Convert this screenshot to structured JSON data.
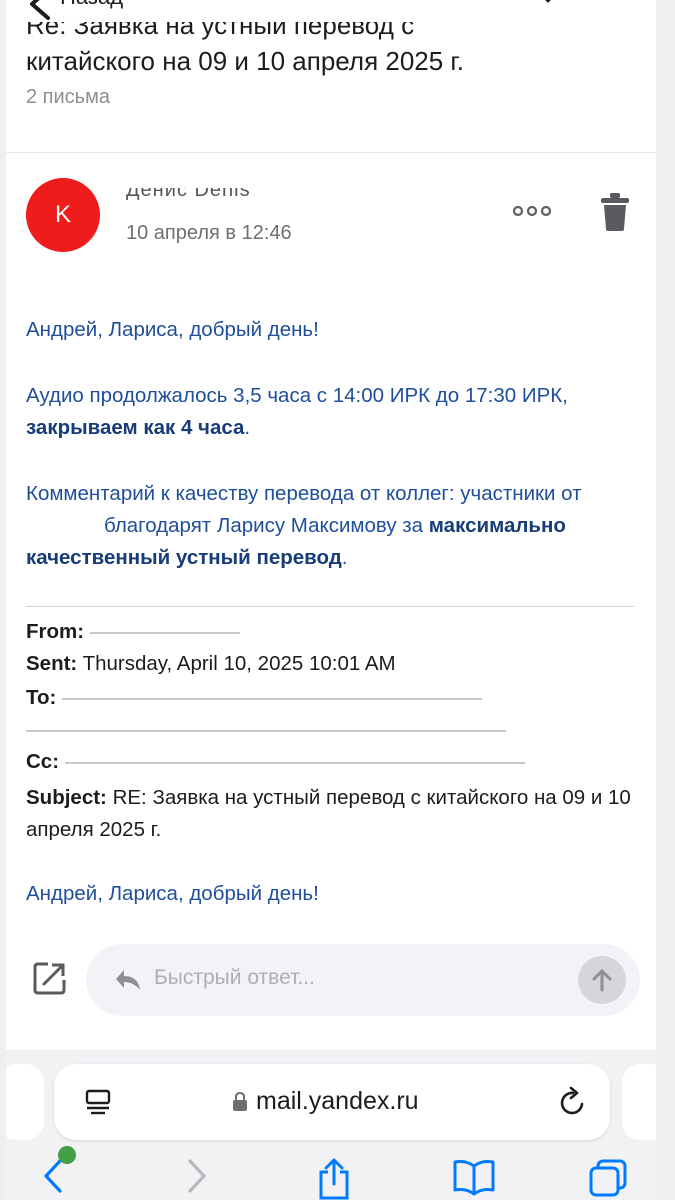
{
  "nav": {
    "back_label": "Назад"
  },
  "thread": {
    "subject_line1": "Re: Заявка на устный перевод с",
    "subject_line2": "китайского на 09 и 10 апреля 2025 г.",
    "letters_count": "2 письма"
  },
  "message": {
    "avatar_letter": "K",
    "avatar_color": "#ef1c1c",
    "sender_name": "Денис Denis",
    "date": "10 апреля в 12:46",
    "greeting": "Андрей, Лариса, добрый день!",
    "p2_text": "Аудио продолжалось 3,5 часа с 14:00 ИРК до 17:30 ИРК, ",
    "p2_bold": "закрываем как 4 часа",
    "p2_end": ".",
    "p3_text1": "Комментарий к качеству перевода от коллег: участники от",
    "p3_text2": "благодарят Ларису Максимову за ",
    "p3_bold": "максимально качественный устный перевод",
    "p3_end": ".",
    "quote": {
      "from_label": "From:",
      "sent_label": "Sent:",
      "sent_value": "Thursday, April 10, 2025 10:01 AM",
      "to_label": "To:",
      "cc_label": "Cc:",
      "subject_label": "Subject:",
      "subject_value": "RE: Заявка на устный перевод с китайского на 09 и 10 апреля 2025 г.",
      "greeting": "Андрей, Лариса, добрый день!"
    }
  },
  "quick_reply": {
    "placeholder": "Быстрый ответ..."
  },
  "browser": {
    "url": "mail.yandex.ru"
  },
  "colors": {
    "link_text": "#1f4e9a",
    "accent": "#007aff",
    "tab_dot": "#43a047"
  }
}
